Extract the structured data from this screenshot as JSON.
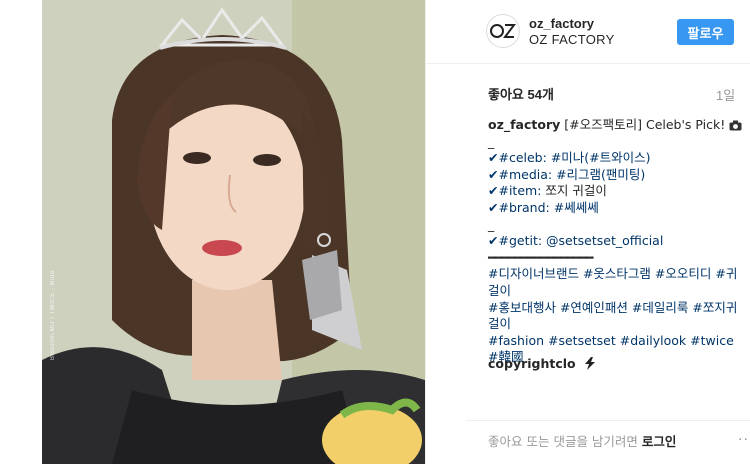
{
  "post": {
    "watermark": "Blossom.Miz / TWICE - Mina",
    "image_alt": "photo-of-idol-wearing-tiara"
  },
  "header": {
    "avatar_text": "OZ",
    "username": "oz_factory",
    "fullname": "OZ FACTORY",
    "follow_label": "팔로우",
    "follow_color": "#3897f0"
  },
  "meta": {
    "likes": "좋아요 54개",
    "time": "1일"
  },
  "caption": {
    "author": "oz_factory",
    "line1_rest": "[#오즈팩토리] Celeb's Pick!",
    "dash1": "_",
    "celeb_prefix": "✔#celeb:",
    "celeb_value": "#미나(#트와이스)",
    "media_prefix": "✔#media:",
    "media_value": "#리그램(팬미팅)",
    "item_prefix": "✔#item:",
    "item_value": "쪼지 귀걸이",
    "brand_prefix": "✔#brand:",
    "brand_value": "#쎄쎄쎄",
    "dash2": "_",
    "getit_prefix": "✔#getit:",
    "getit_value": "@setsetset_official",
    "rule": "━━━━━━━━━━━━━━━━",
    "tags1": "#디자이너브랜드 #옷스타그램 #오오티디 #귀걸이",
    "tags2": "#홍보대행사 #연예인패션 #데일리룩 #쪼지귀걸이",
    "tags3": "#fashion #setsetset #dailylook #twice #韓國"
  },
  "comment": {
    "username": "copyrightclo"
  },
  "footer": {
    "prompt": "좋아요 또는 댓글을 남기려면",
    "login": "로그인",
    "more": "..."
  }
}
